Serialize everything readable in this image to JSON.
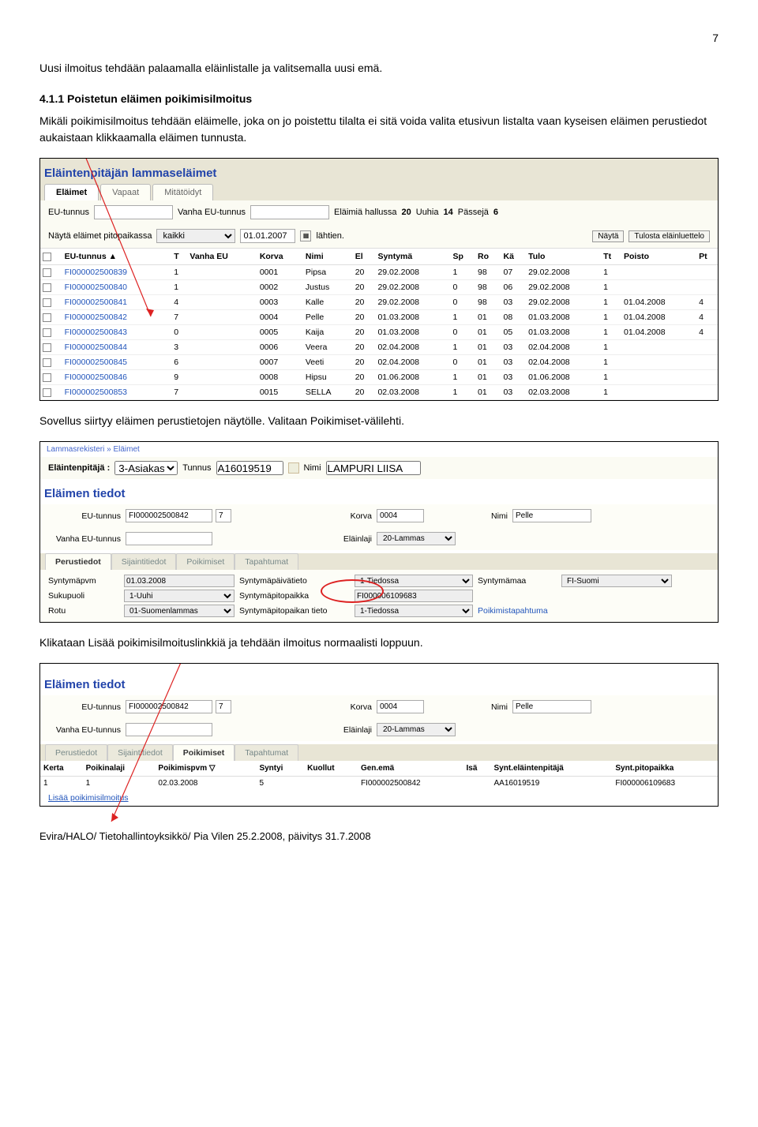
{
  "page_number": "7",
  "intro_text": "Uusi ilmoitus tehdään palaamalla eläinlistalle ja valitsemalla uusi emä.",
  "section_heading": "4.1.1 Poistetun eläimen poikimisilmoitus",
  "section_body": "Mikäli poikimisilmoitus tehdään eläimelle, joka on jo poistettu tilalta ei sitä voida valita etusivun listalta vaan kyseisen eläimen perustiedot aukaistaan klikkaamalla eläimen tunnusta.",
  "mid_text": "Sovellus siirtyy eläimen perustietojen näytölle. Valitaan Poikimiset-välilehti.",
  "bottom_text": "Klikataan Lisää poikimisilmoituslinkkiä ja tehdään ilmoitus normaalisti loppuun.",
  "footer_text": "Evira/HALO/ Tietohallintoyksikkö/ Pia Vilen 25.2.2008, päivitys 31.7.2008",
  "shot1": {
    "title": "Eläintenpitäjän lammaseläimet",
    "tabs": [
      "Eläimet",
      "Vapaat",
      "Mitätöidyt"
    ],
    "labels": {
      "eu": "EU-tunnus",
      "vanha": "Vanha EU-tunnus",
      "hallussa": "Eläimiä hallussa",
      "hallussa_v": "20",
      "uuhia": "Uuhia",
      "uuhia_v": "14",
      "passeja": "Pässejä",
      "passeja_v": "6",
      "nayta": "Näytä eläimet pitopaikassa",
      "pitopaikka": "kaikki",
      "pvm": "01.01.2007",
      "lahtien": "lähtien.",
      "btn_nayta": "Näytä",
      "btn_tulosta": "Tulosta eläinluettelo"
    },
    "headers": [
      "",
      "EU-tunnus ▲",
      "T",
      "Vanha EU",
      "Korva",
      "Nimi",
      "El",
      "Syntymä",
      "Sp",
      "Ro",
      "Kä",
      "Tulo",
      "Tt",
      "Poisto",
      "Pt"
    ],
    "rows": [
      [
        "FI000002500839",
        "1",
        "",
        "0001",
        "Pipsa",
        "20",
        "29.02.2008",
        "1",
        "98",
        "07",
        "29.02.2008",
        "1",
        "",
        ""
      ],
      [
        "FI000002500840",
        "1",
        "",
        "0002",
        "Justus",
        "20",
        "29.02.2008",
        "0",
        "98",
        "06",
        "29.02.2008",
        "1",
        "",
        ""
      ],
      [
        "FI000002500841",
        "4",
        "",
        "0003",
        "Kalle",
        "20",
        "29.02.2008",
        "0",
        "98",
        "03",
        "29.02.2008",
        "1",
        "01.04.2008",
        "4"
      ],
      [
        "FI000002500842",
        "7",
        "",
        "0004",
        "Pelle",
        "20",
        "01.03.2008",
        "1",
        "01",
        "08",
        "01.03.2008",
        "1",
        "01.04.2008",
        "4"
      ],
      [
        "FI000002500843",
        "0",
        "",
        "0005",
        "Kaija",
        "20",
        "01.03.2008",
        "0",
        "01",
        "05",
        "01.03.2008",
        "1",
        "01.04.2008",
        "4"
      ],
      [
        "FI000002500844",
        "3",
        "",
        "0006",
        "Veera",
        "20",
        "02.04.2008",
        "1",
        "01",
        "03",
        "02.04.2008",
        "1",
        "",
        ""
      ],
      [
        "FI000002500845",
        "6",
        "",
        "0007",
        "Veeti",
        "20",
        "02.04.2008",
        "0",
        "01",
        "03",
        "02.04.2008",
        "1",
        "",
        ""
      ],
      [
        "FI000002500846",
        "9",
        "",
        "0008",
        "Hipsu",
        "20",
        "01.06.2008",
        "1",
        "01",
        "03",
        "01.06.2008",
        "1",
        "",
        ""
      ],
      [
        "FI000002500853",
        "7",
        "",
        "0015",
        "SELLA",
        "20",
        "02.03.2008",
        "1",
        "01",
        "03",
        "02.03.2008",
        "1",
        "",
        ""
      ]
    ]
  },
  "shot2": {
    "breadcrumb": "Lammasrekisteri » Eläimet",
    "owner": {
      "label": "Eläintenpitäjä :",
      "type": "3-Asiakas",
      "tunnus_l": "Tunnus",
      "tunnus": "A16019519",
      "nimi_l": "Nimi",
      "nimi": "LAMPURI LIISA"
    },
    "title": "Eläimen tiedot",
    "fields": {
      "eu_l": "EU-tunnus",
      "eu": "FI000002500842",
      "eu2": "7",
      "vanha_l": "Vanha EU-tunnus",
      "vanha": "",
      "korva_l": "Korva",
      "korva": "0004",
      "laji_l": "Eläinlaji",
      "laji": "20-Lammas",
      "nimi_l": "Nimi",
      "nimi": "Pelle"
    },
    "tabs": [
      "Perustiedot",
      "Sijaintitiedot",
      "Poikimiset",
      "Tapahtumat"
    ],
    "details": {
      "sp_l": "Syntymäpvm",
      "sp": "01.03.2008",
      "spt_l": "Syntymäpäivätieto",
      "spt": "1-Tiedossa",
      "smaa_l": "Syntymämaa",
      "smaa": "FI-Suomi",
      "suku_l": "Sukupuoli",
      "suku": "1-Uuhi",
      "spp_l": "Syntymäpitopaikka",
      "spp": "FI000006109683",
      "rotu_l": "Rotu",
      "rotu": "01-Suomenlammas",
      "sppt_l": "Syntymäpitopaikan tieto",
      "sppt": "1-Tiedossa",
      "pt_l": "Poikimistapahtuma"
    }
  },
  "shot3": {
    "title": "Eläimen tiedot",
    "fields": {
      "eu_l": "EU-tunnus",
      "eu": "FI000002500842",
      "eu2": "7",
      "vanha_l": "Vanha EU-tunnus",
      "vanha": "",
      "korva_l": "Korva",
      "korva": "0004",
      "laji_l": "Eläinlaji",
      "laji": "20-Lammas",
      "nimi_l": "Nimi",
      "nimi": "Pelle"
    },
    "tabs": [
      "Perustiedot",
      "Sijaintitiedot",
      "Poikimiset",
      "Tapahtumat"
    ],
    "table_headers": [
      "Kerta",
      "Poikinalaji",
      "Poikimispvm ▽",
      "Syntyi",
      "Kuollut",
      "Gen.emä",
      "Isä",
      "Synt.eläintenpitäjä",
      "Synt.pitopaikka"
    ],
    "table_row": [
      "1",
      "1",
      "02.03.2008",
      "5",
      "",
      "FI000002500842",
      "",
      "AA16019519",
      "FI000006109683"
    ],
    "add_link": "Lisää poikimisilmoitus"
  }
}
